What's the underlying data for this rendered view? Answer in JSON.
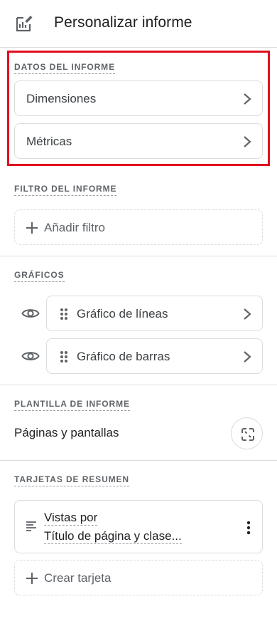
{
  "header": {
    "title": "Personalizar informe",
    "icon": "chart-edit-icon"
  },
  "report_data": {
    "label": "DATOS DEL INFORME",
    "items": [
      {
        "label": "Dimensiones",
        "icon": "chevron-right-icon"
      },
      {
        "label": "Métricas",
        "icon": "chevron-right-icon"
      }
    ]
  },
  "report_filter": {
    "label": "FILTRO DEL INFORME",
    "add_label": "Añadir filtro"
  },
  "charts": {
    "label": "GRÁFICOS",
    "items": [
      {
        "label": "Gráfico de líneas",
        "visibility_icon": "eye-icon",
        "handle_icon": "drag-handle-icon"
      },
      {
        "label": "Gráfico de barras",
        "visibility_icon": "eye-icon",
        "handle_icon": "drag-handle-icon"
      }
    ]
  },
  "report_template": {
    "label": "PLANTILLA DE INFORME",
    "name": "Páginas y pantallas",
    "action_icon": "unlink-icon"
  },
  "summary_cards": {
    "label": "TARJETAS DE RESUMEN",
    "cards": [
      {
        "line1": "Vistas por",
        "line2": "Título de página y clase...",
        "icon": "lines-icon",
        "menu_icon": "more-vert-icon"
      }
    ],
    "create_label": "Crear tarjeta"
  },
  "colors": {
    "highlight": "#e0101f",
    "border": "#dadce0",
    "text": "#202124",
    "muted": "#5f6368"
  }
}
